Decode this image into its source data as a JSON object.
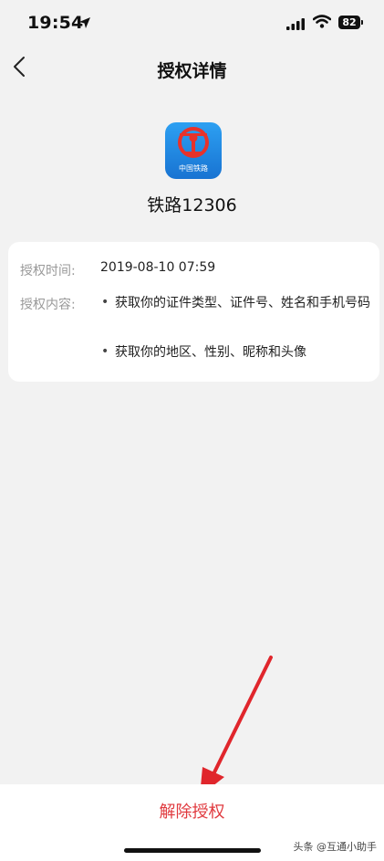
{
  "status": {
    "time": "19:54",
    "battery": "82"
  },
  "nav": {
    "title": "授权详情",
    "back_icon": "chevron-left-icon"
  },
  "app": {
    "name": "铁路12306",
    "icon_label": "中国铁路",
    "icon_color": "#1f86e0"
  },
  "detail": {
    "time_label": "授权时间:",
    "time_value": "2019-08-10 07:59",
    "content_label": "授权内容:",
    "items": [
      "获取你的证件类型、证件号、姓名和手机号码",
      "获取你的地区、性别、昵称和头像"
    ]
  },
  "footer": {
    "revoke_label": "解除授权",
    "accent": "#e0393e"
  },
  "watermark": "头条 @互通小助手"
}
